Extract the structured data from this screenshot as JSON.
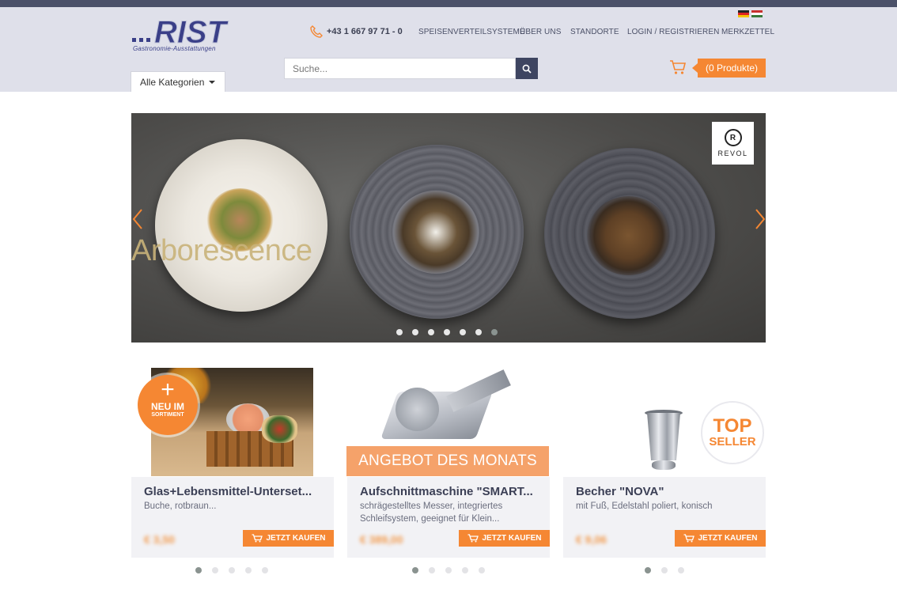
{
  "header": {
    "logo_text": "RIST",
    "logo_subtitle": "Gastronomie-Ausstattungen",
    "phone": "+43 1 667 97 71 - 0",
    "nav": [
      "SPEISENVERTEILSYSTEME",
      "ÜBER UNS",
      "STANDORTE",
      "LOGIN / REGISTRIEREN",
      "MERKZETTEL"
    ],
    "search_placeholder": "Suche...",
    "category_label": "Alle Kategorien",
    "cart_label": "(0 Produkte)",
    "colors": {
      "accent": "#f58733",
      "header_bg": "#dfe0ea",
      "dark": "#3e4561"
    }
  },
  "hero": {
    "caption": "Arborescence",
    "brand": "REVOL",
    "brand_mark": "R",
    "slide_count": 7,
    "active_slide": 7
  },
  "products": [
    {
      "title": "Glas+Lebensmittel-Unterset...",
      "desc": "Buche, rotbraun...",
      "price": "€ 3,50",
      "badge_line1": "NEU IM",
      "badge_line2": "SORTIMENT",
      "buy": "JETZT KAUFEN",
      "dots": 5,
      "active_dot": 1
    },
    {
      "title": "Aufschnittmaschine \"SMART...",
      "desc": "schrägestelltes Messer, integriertes Schleifsystem, geeignet für Klein...",
      "price": "€ 389,00",
      "offer": "ANGEBOT DES MONATS",
      "buy": "JETZT KAUFEN",
      "dots": 5,
      "active_dot": 1
    },
    {
      "title": "Becher \"NOVA\"",
      "desc": "mit Fuß, Edelstahl poliert, konisch",
      "price": "€ 9,06",
      "badge_line1": "TOP",
      "badge_line2": "SELLER",
      "buy": "JETZT KAUFEN",
      "dots": 3,
      "active_dot": 1
    }
  ]
}
